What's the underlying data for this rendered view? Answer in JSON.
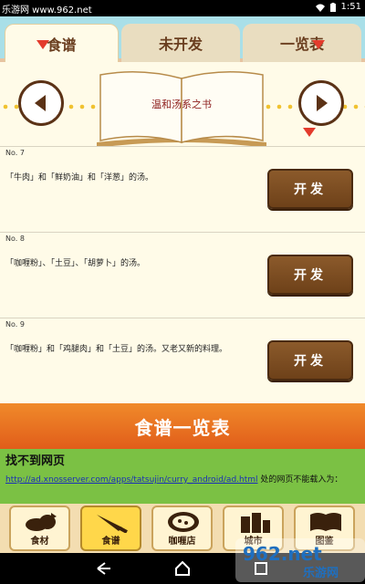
{
  "status_bar": {
    "left_text": "乐游网 www.962.net",
    "time": "1:51"
  },
  "tabs": [
    {
      "label": "食谱",
      "active": true
    },
    {
      "label": "未开发",
      "active": false
    },
    {
      "label": "一览表",
      "active": false
    }
  ],
  "book": {
    "title": "温和汤系之书"
  },
  "recipes": [
    {
      "number": "No. 7",
      "description": "「牛肉」和「鲜奶油」和「洋葱」的汤。",
      "button": "开发"
    },
    {
      "number": "No. 8",
      "description": "「咖喱粉」、「土豆」、「胡萝卜」的汤。",
      "button": "开发"
    },
    {
      "number": "No. 9",
      "description": "「咖喱粉」和「鸡腿肉」和「土豆」的汤。又老又新的料理。",
      "button": "开发"
    }
  ],
  "banner": {
    "label": "食谱一览表"
  },
  "webview_error": {
    "title": "找不到网页",
    "url": "http://ad.xnosserver.com/apps/tatsujin/curry_android/ad.html",
    "message_suffix": " 处的网页不能载入为："
  },
  "bottom_menu": [
    {
      "label": "食材",
      "icon": "ingredients-icon",
      "active": false
    },
    {
      "label": "食谱",
      "icon": "knife-icon",
      "active": true
    },
    {
      "label": "咖喱店",
      "icon": "curry-plate-icon",
      "active": false
    },
    {
      "label": "城市",
      "icon": "city-icon",
      "active": false
    },
    {
      "label": "图鉴",
      "icon": "book-icon",
      "active": false
    }
  ],
  "watermark": {
    "text": "962.net",
    "subtext": "乐游网"
  },
  "colors": {
    "accent": "#e33b2c",
    "button_brown": "#6e4119",
    "banner_orange": "#e15d1a",
    "webview_green": "#7bc144"
  }
}
